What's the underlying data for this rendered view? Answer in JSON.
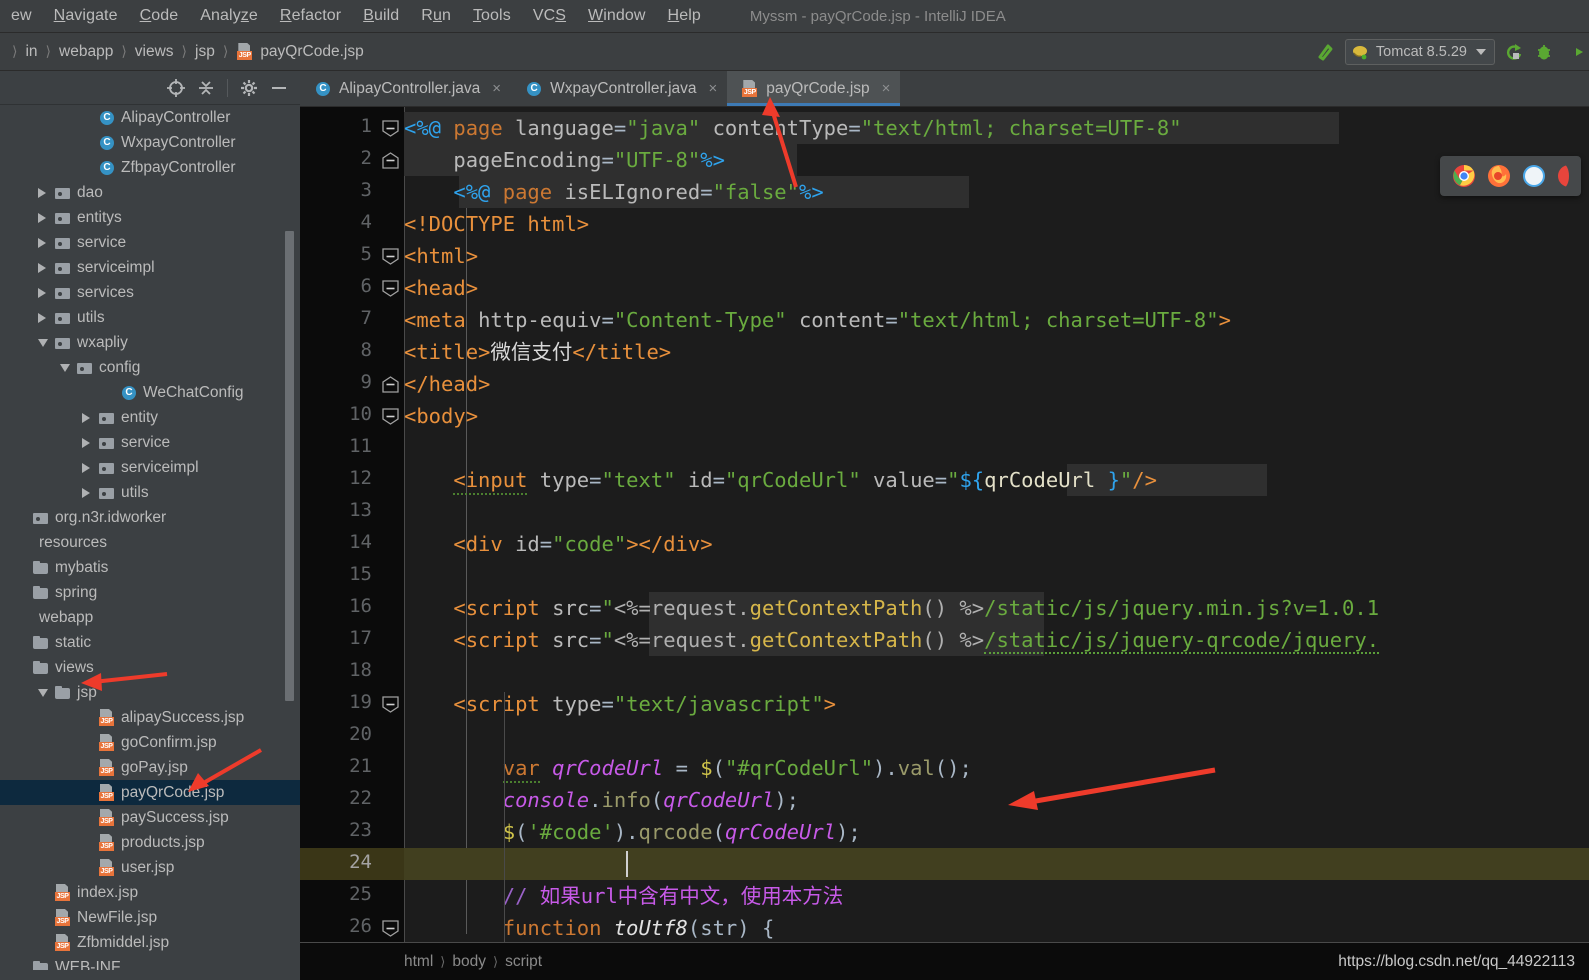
{
  "window": {
    "title": "Myssm - payQrCode.jsp - IntelliJ IDEA"
  },
  "menubar": {
    "items": [
      {
        "label": "ew",
        "mnemonic": ""
      },
      {
        "label": "Navigate",
        "mnemonic": "N"
      },
      {
        "label": "Code",
        "mnemonic": "C"
      },
      {
        "label": "Analyze",
        "mnemonic": "z"
      },
      {
        "label": "Refactor",
        "mnemonic": "R"
      },
      {
        "label": "Build",
        "mnemonic": "B"
      },
      {
        "label": "Run",
        "mnemonic": "u"
      },
      {
        "label": "Tools",
        "mnemonic": "T"
      },
      {
        "label": "VCS",
        "mnemonic": "S"
      },
      {
        "label": "Window",
        "mnemonic": "W"
      },
      {
        "label": "Help",
        "mnemonic": "H"
      }
    ]
  },
  "navbar": {
    "crumbs": [
      "in",
      "webapp",
      "views",
      "jsp",
      "payQrCode.jsp"
    ],
    "run_config": "Tomcat 8.5.29",
    "icons": [
      "build-hammer-icon",
      "tomcat-icon",
      "chevron-down-icon",
      "rerun-icon",
      "debug-bug-icon",
      "run-with-coverage-icon"
    ]
  },
  "sidebar": {
    "toolbar_icons": [
      "locate-target-icon",
      "collapse-all-icon",
      "gear-icon",
      "minimize-icon"
    ],
    "tree": [
      {
        "label": "AlipayController",
        "indent": 3,
        "icon": "class-icon",
        "twisty": "none",
        "selected": false
      },
      {
        "label": "WxpayController",
        "indent": 3,
        "icon": "class-icon",
        "twisty": "none",
        "selected": false
      },
      {
        "label": "ZfbpayController",
        "indent": 3,
        "icon": "class-icon",
        "twisty": "none",
        "selected": false
      },
      {
        "label": "dao",
        "indent": 1,
        "icon": "package-icon",
        "twisty": "collapsed",
        "selected": false
      },
      {
        "label": "entitys",
        "indent": 1,
        "icon": "package-icon",
        "twisty": "collapsed",
        "selected": false
      },
      {
        "label": "service",
        "indent": 1,
        "icon": "package-icon",
        "twisty": "collapsed",
        "selected": false
      },
      {
        "label": "serviceimpl",
        "indent": 1,
        "icon": "package-icon",
        "twisty": "collapsed",
        "selected": false
      },
      {
        "label": "services",
        "indent": 1,
        "icon": "package-icon",
        "twisty": "collapsed",
        "selected": false
      },
      {
        "label": "utils",
        "indent": 1,
        "icon": "package-icon",
        "twisty": "collapsed",
        "selected": false
      },
      {
        "label": "wxapliy",
        "indent": 1,
        "icon": "package-icon",
        "twisty": "expanded",
        "selected": false
      },
      {
        "label": "config",
        "indent": 2,
        "icon": "package-icon",
        "twisty": "expanded",
        "selected": false
      },
      {
        "label": "WeChatConfig",
        "indent": 4,
        "icon": "class-icon",
        "twisty": "none",
        "selected": false
      },
      {
        "label": "entity",
        "indent": 3,
        "icon": "package-icon",
        "twisty": "collapsed",
        "selected": false
      },
      {
        "label": "service",
        "indent": 3,
        "icon": "package-icon",
        "twisty": "collapsed",
        "selected": false
      },
      {
        "label": "serviceimpl",
        "indent": 3,
        "icon": "package-icon",
        "twisty": "collapsed",
        "selected": false
      },
      {
        "label": "utils",
        "indent": 3,
        "icon": "package-icon",
        "twisty": "collapsed",
        "selected": false
      },
      {
        "label": "org.n3r.idworker",
        "indent": 0,
        "icon": "package-icon",
        "twisty": "none",
        "selected": false
      },
      {
        "label": "resources",
        "indent": 0,
        "icon": "none",
        "twisty": "none",
        "selected": false
      },
      {
        "label": "mybatis",
        "indent": 0,
        "icon": "folder-icon",
        "twisty": "none",
        "selected": false
      },
      {
        "label": "spring",
        "indent": 0,
        "icon": "folder-icon",
        "twisty": "none",
        "selected": false
      },
      {
        "label": "webapp",
        "indent": 0,
        "icon": "none",
        "twisty": "none",
        "selected": false
      },
      {
        "label": "static",
        "indent": 0,
        "icon": "folder-icon",
        "twisty": "none",
        "selected": false
      },
      {
        "label": "views",
        "indent": 0,
        "icon": "folder-icon",
        "twisty": "none",
        "selected": false
      },
      {
        "label": "jsp",
        "indent": 1,
        "icon": "folder-icon",
        "twisty": "expanded",
        "selected": false
      },
      {
        "label": "alipaySuccess.jsp",
        "indent": 3,
        "icon": "jsp-icon",
        "twisty": "none",
        "selected": false
      },
      {
        "label": "goConfirm.jsp",
        "indent": 3,
        "icon": "jsp-icon",
        "twisty": "none",
        "selected": false
      },
      {
        "label": "goPay.jsp",
        "indent": 3,
        "icon": "jsp-icon",
        "twisty": "none",
        "selected": false
      },
      {
        "label": "payQrCode.jsp",
        "indent": 3,
        "icon": "jsp-icon",
        "twisty": "none",
        "selected": true
      },
      {
        "label": "paySuccess.jsp",
        "indent": 3,
        "icon": "jsp-icon",
        "twisty": "none",
        "selected": false
      },
      {
        "label": "products.jsp",
        "indent": 3,
        "icon": "jsp-icon",
        "twisty": "none",
        "selected": false
      },
      {
        "label": "user.jsp",
        "indent": 3,
        "icon": "jsp-icon",
        "twisty": "none",
        "selected": false
      },
      {
        "label": "index.jsp",
        "indent": 1,
        "icon": "jsp-icon",
        "twisty": "none",
        "selected": false
      },
      {
        "label": "NewFile.jsp",
        "indent": 1,
        "icon": "jsp-icon",
        "twisty": "none",
        "selected": false
      },
      {
        "label": "Zfbmiddel.jsp",
        "indent": 1,
        "icon": "jsp-icon",
        "twisty": "none",
        "selected": false
      },
      {
        "label": "WEB-INF",
        "indent": 0,
        "icon": "folder-icon",
        "twisty": "none",
        "selected": false
      }
    ]
  },
  "editor": {
    "tabs": [
      {
        "label": "AlipayController.java",
        "icon": "class-icon",
        "active": false,
        "close": "×"
      },
      {
        "label": "WxpayController.java",
        "icon": "class-icon",
        "active": false,
        "close": "×"
      },
      {
        "label": "payQrCode.jsp",
        "icon": "jsp-icon",
        "active": true,
        "close": "×"
      }
    ],
    "first_line": 1,
    "caret_line": 24,
    "lines": [
      {
        "n": 1,
        "text": "<%@ page language=\"java\" contentType=\"text/html; charset=UTF-8\"",
        "fold": "start"
      },
      {
        "n": 2,
        "text": "    pageEncoding=\"UTF-8\"%>",
        "fold": "end"
      },
      {
        "n": 3,
        "text": "    <%@ page isELIgnored=\"false\"%>",
        "fold": "none"
      },
      {
        "n": 4,
        "text": "<!DOCTYPE html>",
        "fold": "none"
      },
      {
        "n": 5,
        "text": "<html>",
        "fold": "start"
      },
      {
        "n": 6,
        "text": "<head>",
        "fold": "start"
      },
      {
        "n": 7,
        "text": "<meta http-equiv=\"Content-Type\" content=\"text/html; charset=UTF-8\">",
        "fold": "none"
      },
      {
        "n": 8,
        "text": "<title>微信支付</title>",
        "fold": "none"
      },
      {
        "n": 9,
        "text": "</head>",
        "fold": "end"
      },
      {
        "n": 10,
        "text": "<body>",
        "fold": "start"
      },
      {
        "n": 11,
        "text": "",
        "fold": "none"
      },
      {
        "n": 12,
        "text": "    <input type=\"text\" id=\"qrCodeUrl\" value=\"${qrCodeUrl }\"/>",
        "fold": "none"
      },
      {
        "n": 13,
        "text": "",
        "fold": "none"
      },
      {
        "n": 14,
        "text": "    <div id=\"code\"></div>",
        "fold": "none"
      },
      {
        "n": 15,
        "text": "",
        "fold": "none"
      },
      {
        "n": 16,
        "text": "    <script src=\"<%=request.getContextPath() %>/static/js/jquery.min.js?v=1.0.1",
        "fold": "none"
      },
      {
        "n": 17,
        "text": "    <script src=\"<%=request.getContextPath() %>/static/js/jquery-qrcode/jquery.",
        "fold": "none"
      },
      {
        "n": 18,
        "text": "",
        "fold": "none"
      },
      {
        "n": 19,
        "text": "    <script type=\"text/javascript\">",
        "fold": "start"
      },
      {
        "n": 20,
        "text": "",
        "fold": "none"
      },
      {
        "n": 21,
        "text": "        var qrCodeUrl = $(\"#qrCodeUrl\").val();",
        "fold": "none"
      },
      {
        "n": 22,
        "text": "        console.info(qrCodeUrl);",
        "fold": "none"
      },
      {
        "n": 23,
        "text": "        $('#code').qrcode(qrCodeUrl);",
        "fold": "none"
      },
      {
        "n": 24,
        "text": "",
        "fold": "none"
      },
      {
        "n": 25,
        "text": "        // 如果url中含有中文，使用本方法",
        "fold": "none"
      },
      {
        "n": 26,
        "text": "        function toUtf8(str) {",
        "fold": "start"
      }
    ],
    "browser_popup": [
      "chrome-icon",
      "firefox-icon",
      "safari-icon",
      "edge-icon"
    ]
  },
  "statusbar": {
    "crumbs": [
      "html",
      "body",
      "script"
    ],
    "watermark": "https://blog.csdn.net/qq_44922113"
  },
  "colors": {
    "accent_blue": "#3d7ab5",
    "selection_blue": "#0d293e",
    "caret_line": "#413f1f",
    "annotation_red": "#ee3b2b",
    "tag_orange": "#e8903c",
    "string_green": "#6aab3f",
    "keyword_orange": "#cc7832",
    "comment_purple": "#9a62c8"
  }
}
